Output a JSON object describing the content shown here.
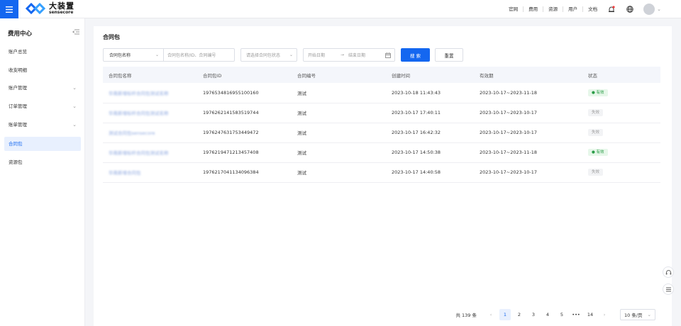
{
  "header": {
    "brand_cn": "大装置",
    "brand_en": "sensecore",
    "nav": [
      "官网",
      "费用",
      "资源",
      "用户",
      "文档"
    ]
  },
  "sidebar": {
    "title": "费用中心",
    "items": [
      {
        "label": "账户总览"
      },
      {
        "label": "收支明细"
      },
      {
        "label": "账户管理"
      },
      {
        "label": "订单管理"
      },
      {
        "label": "账单管理"
      },
      {
        "label": "合同包"
      },
      {
        "label": "资源包"
      }
    ]
  },
  "main": {
    "title": "合同包",
    "filters": {
      "name_select": "合同包名称",
      "search_placeholder": "合同包名称/ID、合同编号",
      "status_placeholder": "请选择合同包状态",
      "start_placeholder": "开始日期",
      "date_sep": "→",
      "end_placeholder": "结束日期",
      "search_label": "搜 索",
      "reset_label": "重置"
    },
    "table": {
      "columns": [
        "合同包名称",
        "合同包ID",
        "合同编号",
        "创建时间",
        "有效期",
        "状态"
      ],
      "rows": [
        {
          "name": "华南新增标杆合同包测试名称",
          "id": "1976534816955100160",
          "code": "测试",
          "created": "2023-10-18 11:43:43",
          "validity": "2023-10-17~2023-11-18",
          "status": "● 有效",
          "active": true
        },
        {
          "name": "华南新增标杆合同包测试名称",
          "id": "1976262141583519744",
          "code": "测试",
          "created": "2023-10-17 17:40:11",
          "validity": "2023-10-17~2023-10-17",
          "status": "失效",
          "active": false
        },
        {
          "name": "测试合同包sensecore",
          "id": "1976247631753449472",
          "code": "测试",
          "created": "2023-10-17 16:42:32",
          "validity": "2023-10-17~2023-10-17",
          "status": "失效",
          "active": false
        },
        {
          "name": "华南新增标杆合同包测试名称",
          "id": "1976219471213457408",
          "code": "测试",
          "created": "2023-10-17 14:50:38",
          "validity": "2023-10-17~2023-11-18",
          "status": "● 有效",
          "active": true
        },
        {
          "name": "华南新增合同包",
          "id": "1976217041134096384",
          "code": "测试",
          "created": "2023-10-17 14:40:58",
          "validity": "2023-10-17~2023-10-17",
          "status": "失效",
          "active": false
        }
      ]
    },
    "pagination": {
      "total": "共 139 条",
      "pages": [
        "1",
        "2",
        "3",
        "4",
        "5"
      ],
      "ellipsis": "•••",
      "last": "14",
      "current": "1",
      "page_size": "10 条/页"
    }
  },
  "colors": {
    "primary": "#1467f0",
    "success": "#2a9c47",
    "page_bg": "#f4f5f8"
  }
}
